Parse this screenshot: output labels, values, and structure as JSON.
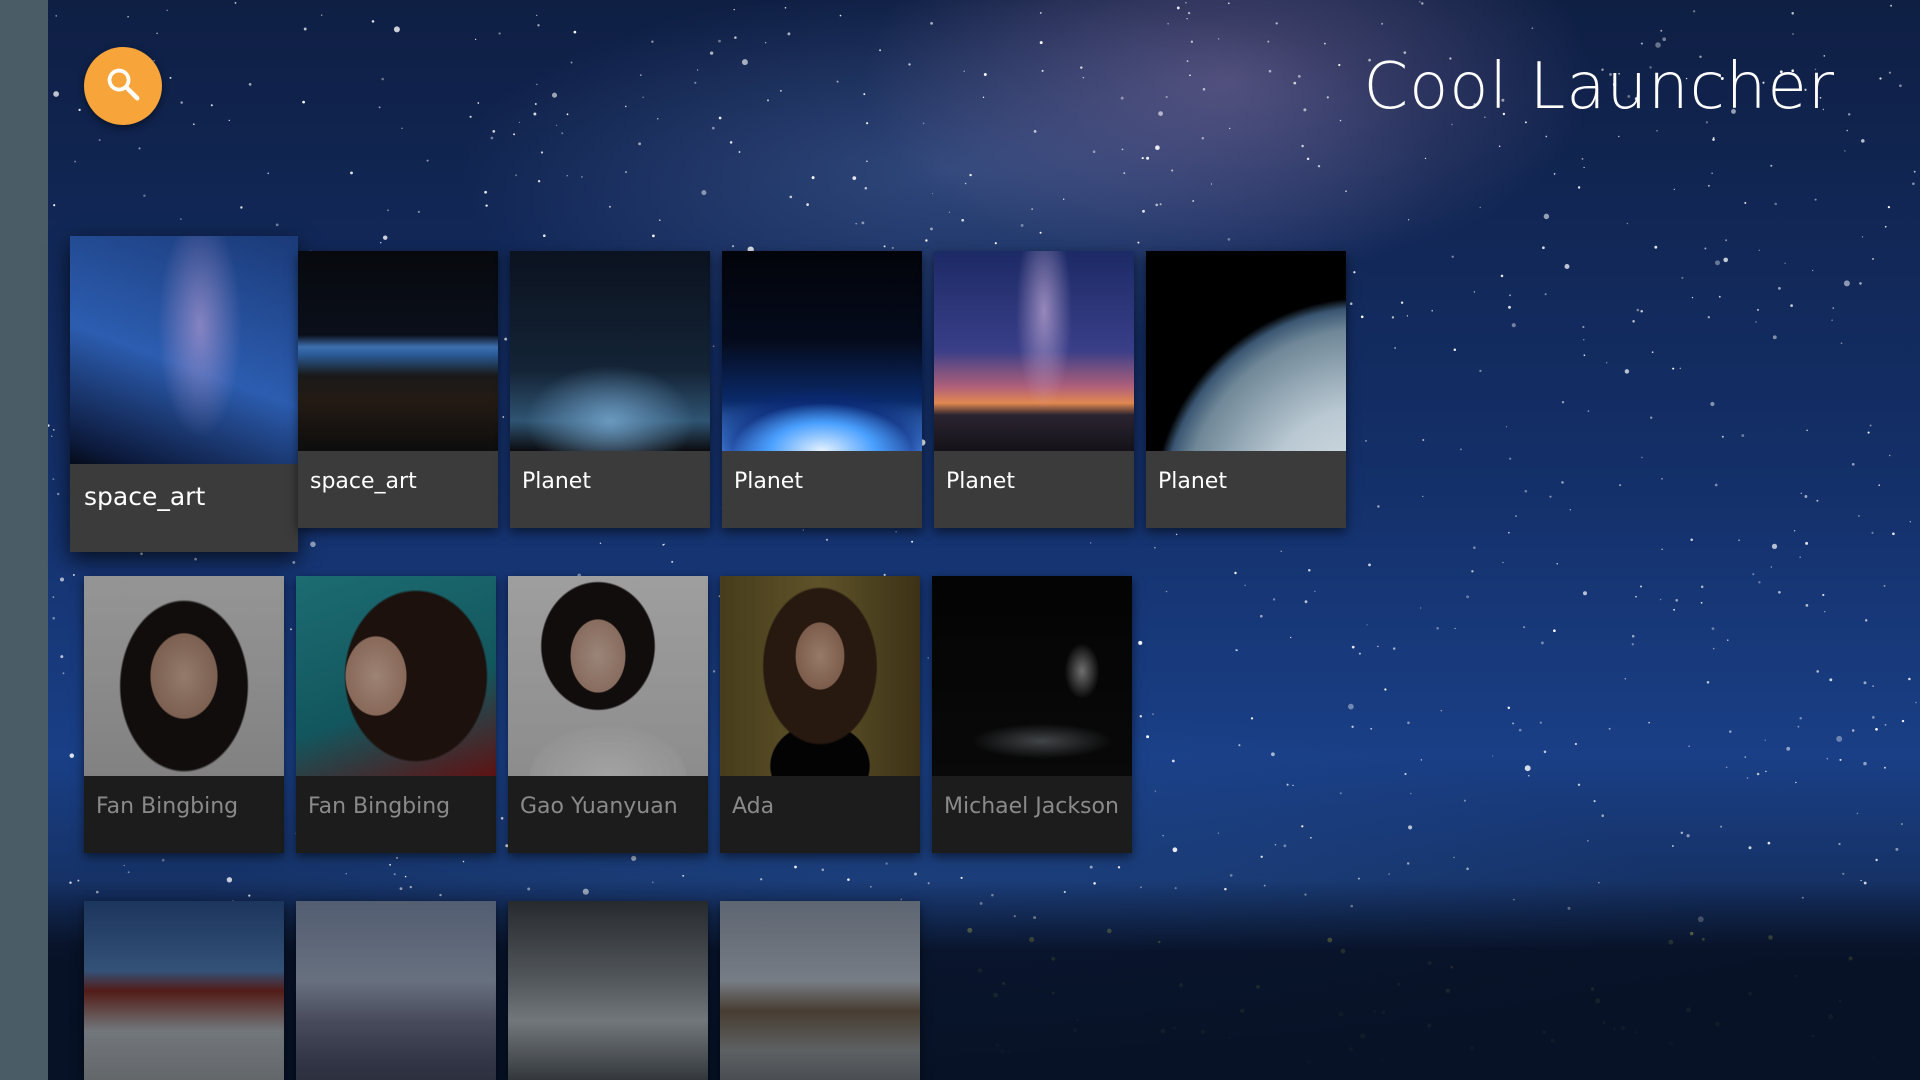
{
  "app_title": "Cool Launcher",
  "search_icon": "search-icon",
  "colors": {
    "accent": "#f7a43a",
    "sidebar": "#4a5d66",
    "card_bg": "#3b3b3b",
    "card_bg_dim": "#1c1c1c"
  },
  "rows": [
    {
      "cards": [
        {
          "label": "space_art",
          "focused": true
        },
        {
          "label": "space_art"
        },
        {
          "label": "Planet"
        },
        {
          "label": "Planet"
        },
        {
          "label": "Planet"
        },
        {
          "label": "Planet"
        }
      ]
    },
    {
      "cards": [
        {
          "label": "Fan Bingbing"
        },
        {
          "label": "Fan Bingbing"
        },
        {
          "label": "Gao Yuanyuan"
        },
        {
          "label": "Ada"
        },
        {
          "label": "Michael Jackson"
        }
      ]
    },
    {
      "cards": [
        {
          "label": ""
        },
        {
          "label": ""
        },
        {
          "label": ""
        },
        {
          "label": ""
        }
      ]
    }
  ]
}
